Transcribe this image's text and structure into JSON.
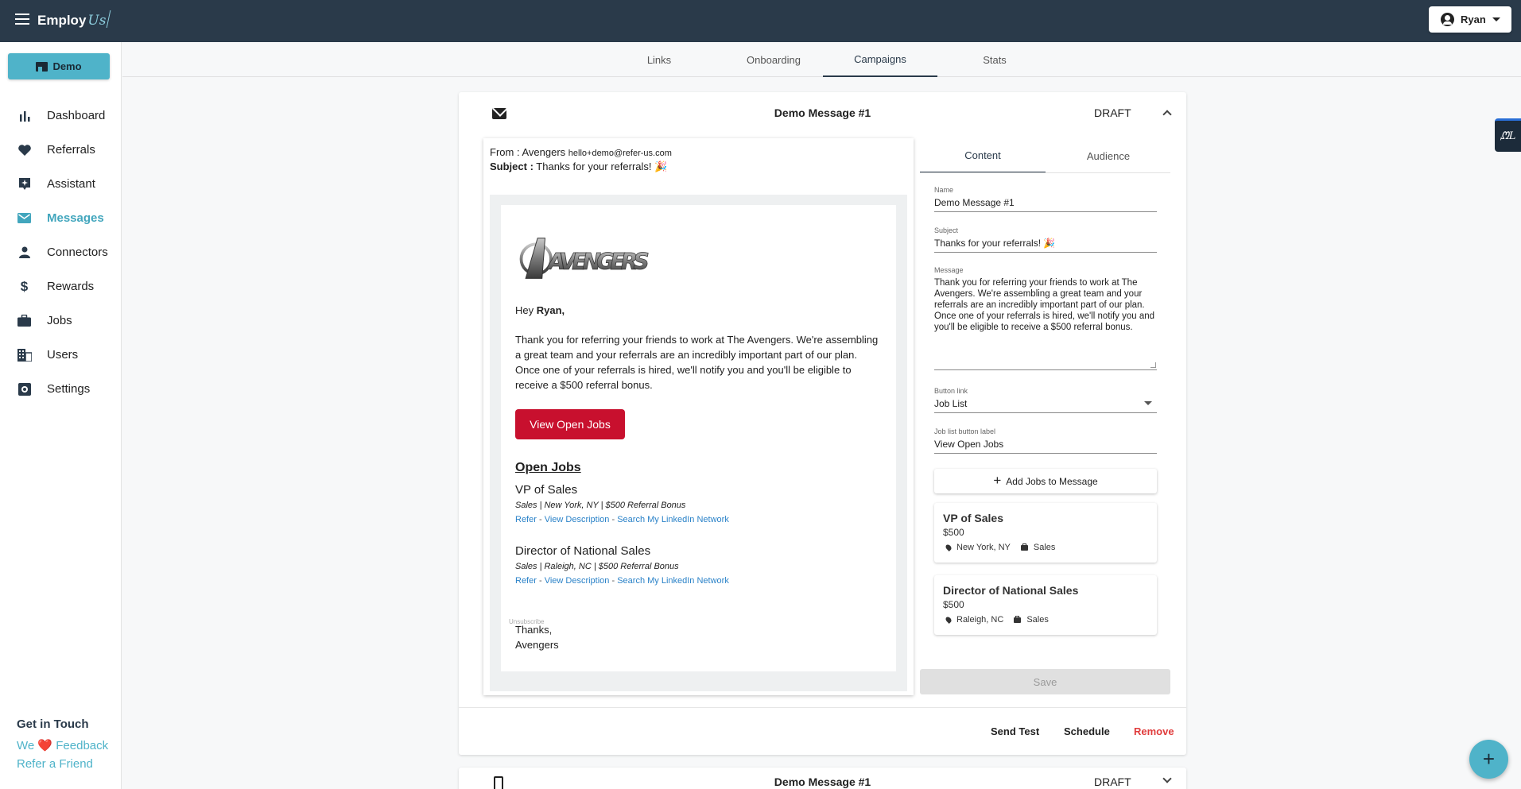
{
  "app": {
    "logo_main": "Employ",
    "logo_accent": "Us",
    "user_name": "Ryan"
  },
  "sidebar": {
    "org_button": "Demo",
    "items": [
      {
        "label": "Dashboard",
        "icon": "bar-chart-icon"
      },
      {
        "label": "Referrals",
        "icon": "heart-icon"
      },
      {
        "label": "Assistant",
        "icon": "assistant-icon"
      },
      {
        "label": "Messages",
        "icon": "mail-icon",
        "active": true
      },
      {
        "label": "Connectors",
        "icon": "person-icon"
      },
      {
        "label": "Rewards",
        "icon": "dollar-icon"
      },
      {
        "label": "Jobs",
        "icon": "briefcase-icon"
      },
      {
        "label": "Users",
        "icon": "building-icon"
      },
      {
        "label": "Settings",
        "icon": "gear-icon"
      }
    ],
    "get_in_touch": "Get in Touch",
    "feedback_pre": "We",
    "feedback_post": "Feedback",
    "refer_friend": "Refer a Friend"
  },
  "tabs": [
    "Links",
    "Onboarding",
    "Campaigns",
    "Stats"
  ],
  "active_tab": "Campaigns",
  "campaign": {
    "title": "Demo Message #1",
    "status": "DRAFT",
    "preview": {
      "from_label": "From :",
      "from_name": "Avengers",
      "from_email": "hello+demo@refer-us.com",
      "subject_label": "Subject :",
      "subject": "Thanks for your referrals! 🎉",
      "logo_text": "AVENGERS",
      "greeting_pre": "Hey",
      "greeting_name": "Ryan,",
      "body": "Thank you for referring your friends to work at The Avengers. We're assembling a great team and your referrals are an incredibly important part of our plan. Once one of your referrals is hired, we'll notify you and you'll be eligible to receive a $500 referral bonus.",
      "button": "View Open Jobs",
      "open_jobs_heading": "Open Jobs",
      "jobs": [
        {
          "title": "VP of Sales",
          "meta": "Sales | New York, NY | $500 Referral Bonus"
        },
        {
          "title": "Director of National Sales",
          "meta": "Sales | Raleigh, NC | $500 Referral Bonus"
        }
      ],
      "link_refer": "Refer",
      "link_sep": " - ",
      "link_desc": "View Description",
      "link_search": "Search My LinkedIn Network",
      "signoff": "Thanks,",
      "signature": "Avengers",
      "unsubscribe": "Unsubscribe"
    },
    "panel": {
      "tabs": [
        "Content",
        "Audience"
      ],
      "name_label": "Name",
      "name_value": "Demo Message #1",
      "subject_label": "Subject",
      "subject_value": "Thanks for your referrals! 🎉",
      "message_label": "Message",
      "message_value": "Thank you for referring your friends to work at The Avengers. We're assembling a great team and your referrals are an incredibly important part of our plan. Once one of your referrals is hired, we'll notify you and you'll be eligible to receive a $500 referral bonus.",
      "button_link_label": "Button link",
      "button_link_value": "Job List",
      "job_list_label": "Job list button label",
      "job_list_value": "View Open Jobs",
      "add_jobs": "Add Jobs to Message",
      "job_cards": [
        {
          "title": "VP of Sales",
          "salary": "$500",
          "location": "New York, NY",
          "dept": "Sales"
        },
        {
          "title": "Director of National Sales",
          "salary": "$500",
          "location": "Raleigh, NC",
          "dept": "Sales"
        }
      ],
      "save": "Save"
    },
    "actions": {
      "send_test": "Send Test",
      "schedule": "Schedule",
      "remove": "Remove"
    }
  },
  "campaign2": {
    "title": "Demo Message #1",
    "status": "DRAFT"
  },
  "colors": {
    "topbar": "#2a3a4a",
    "accent": "#4fb3c9",
    "cta": "#c8102e",
    "remove": "#e03c3c"
  }
}
